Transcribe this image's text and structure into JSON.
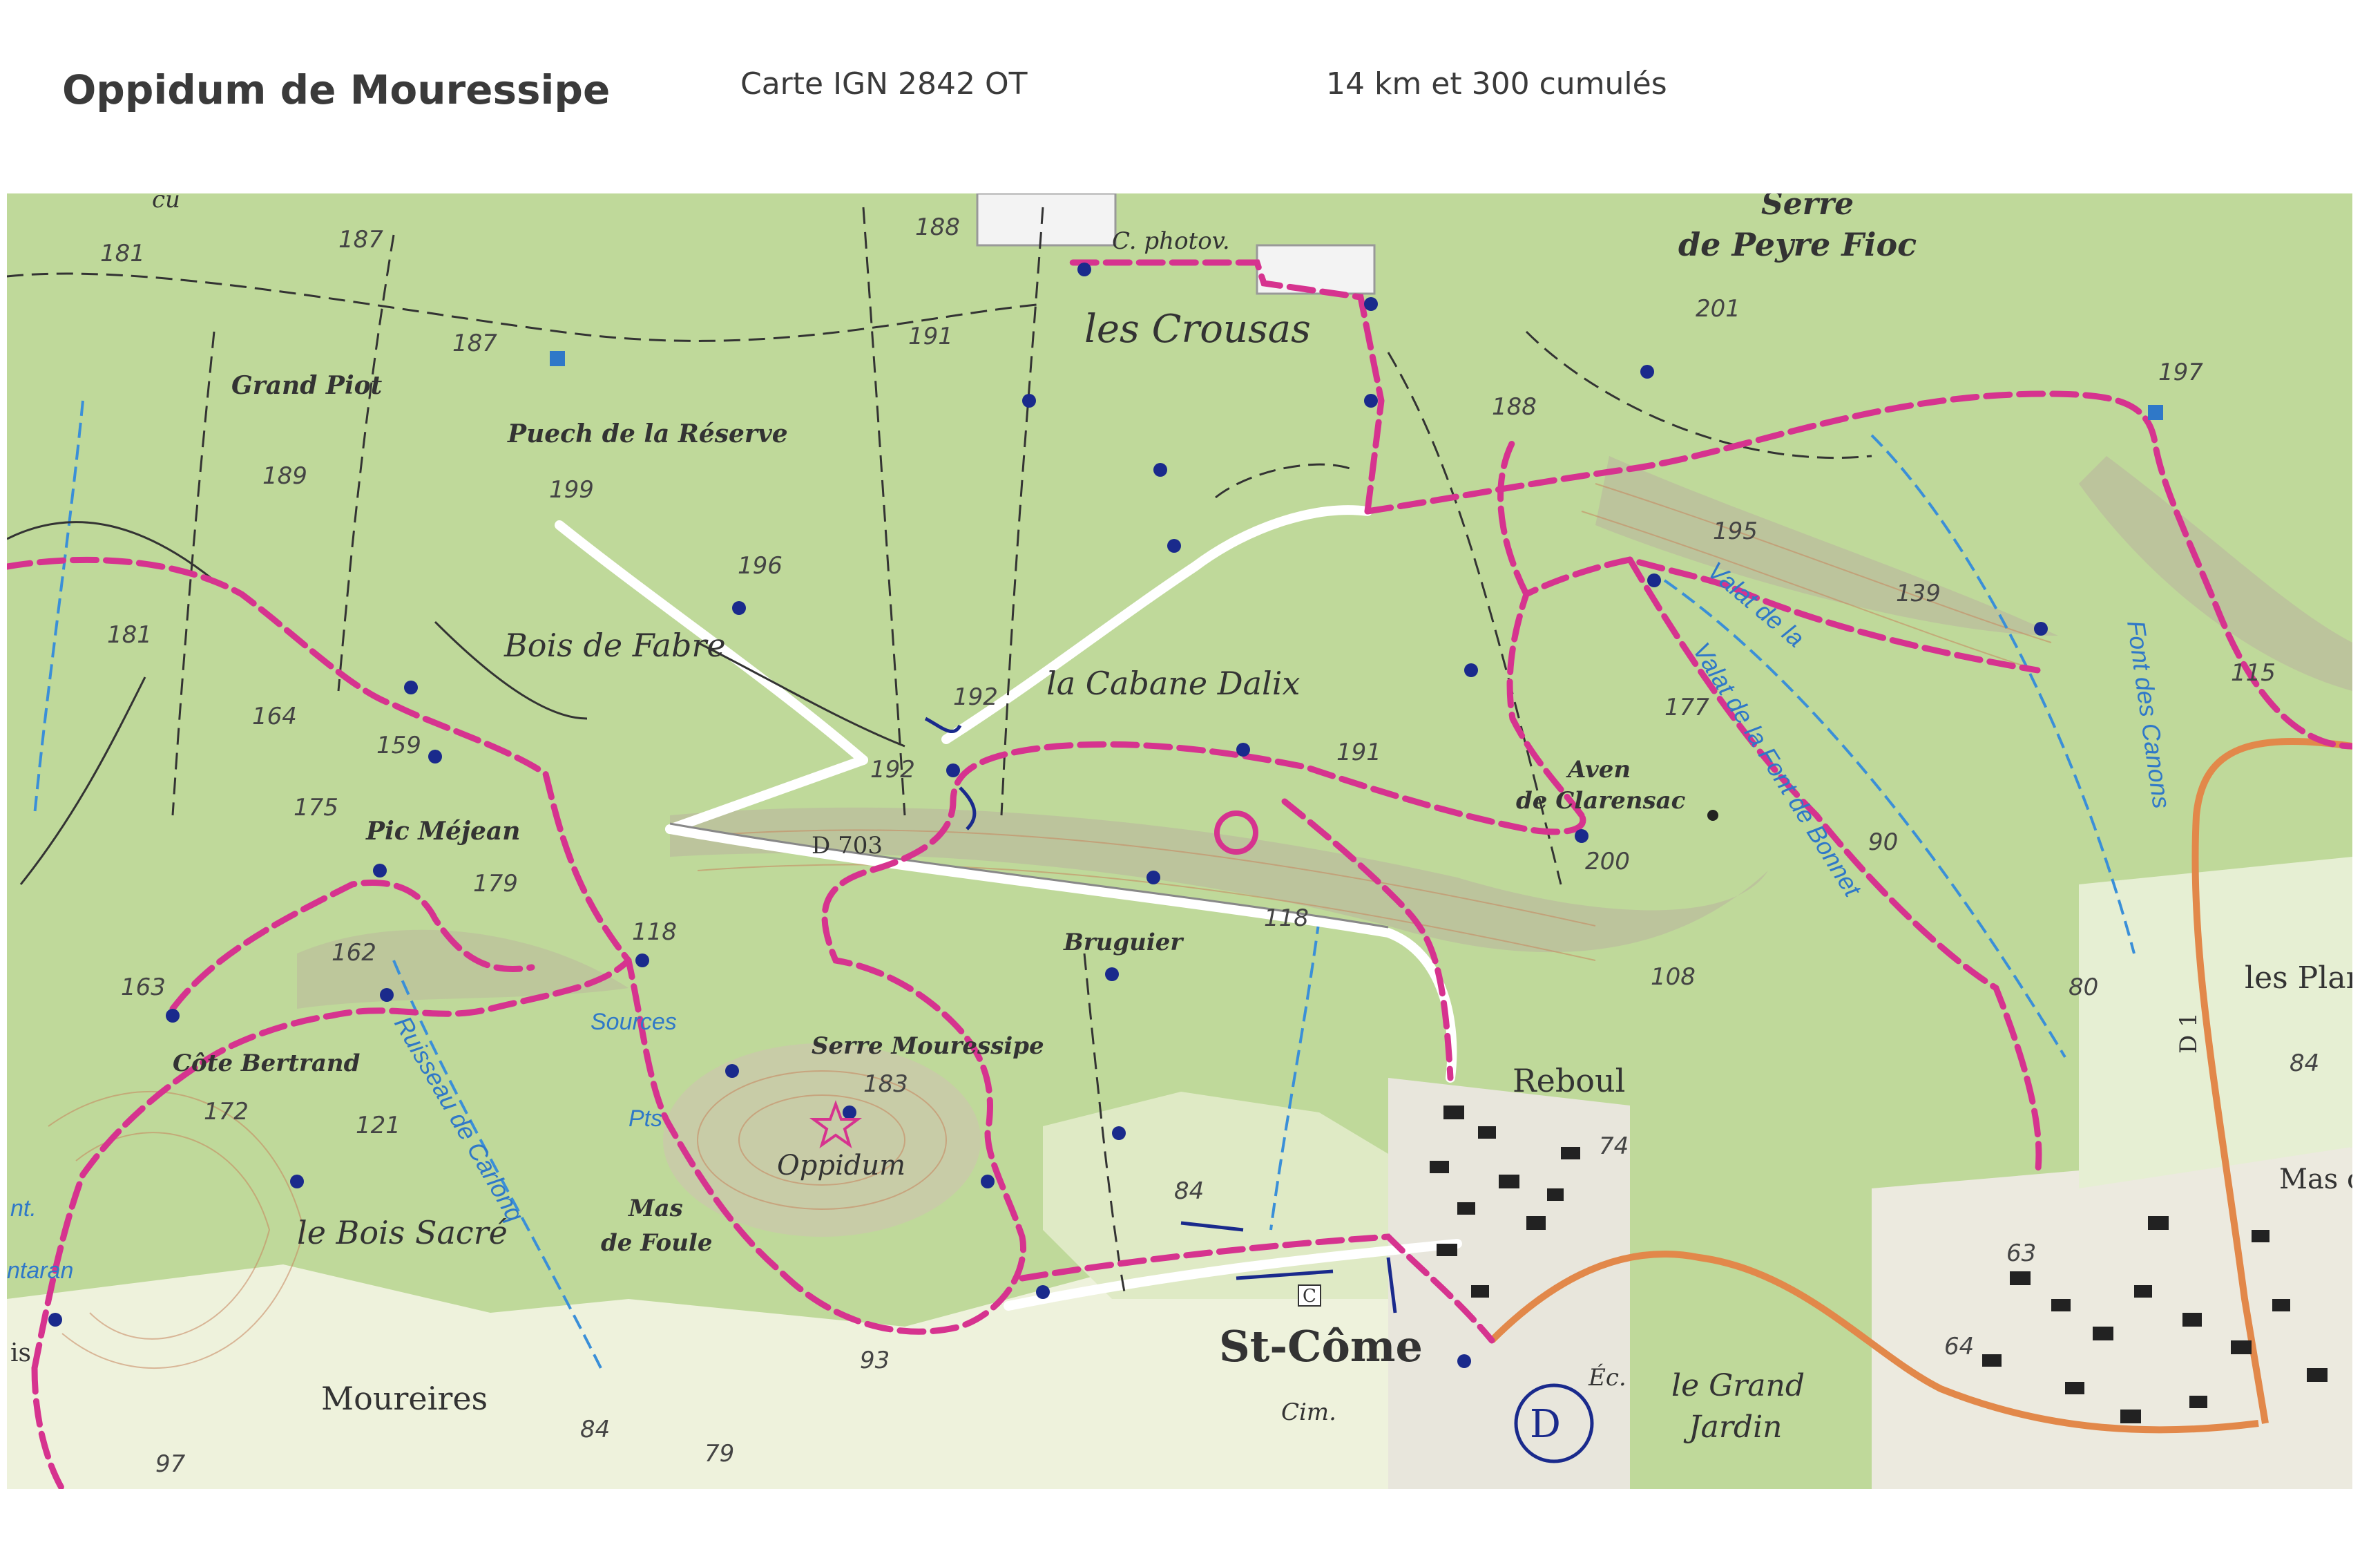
{
  "header": {
    "title": "Oppidum de Mouressipe",
    "map_sheet": "Carte IGN   2842 OT",
    "distance": "14 km et 300 cumulés"
  },
  "map": {
    "labels": {
      "serre_peyre_fioc_1": "Serre",
      "serre_peyre_fioc_2": "de Peyre Fioc",
      "c_photov": "C. photov.",
      "les_crousas": "les Crousas",
      "grand_piot": "Grand Piot",
      "puech_reserve": "Puech de la Réserve",
      "bois_de_fabre": "Bois de Fabre",
      "cabane_dalix": "la Cabane Dalix",
      "aven_1": "Aven",
      "aven_2": "de Clarensac",
      "pic_mejean": "Pic Méjean",
      "d703": "D 703",
      "bruguier": "Bruguier",
      "serre_mouressipe": "Serre Mouressipe",
      "oppidum": "Oppidum",
      "sources": "Sources",
      "pts": "Pts",
      "cote_bertrand": "Côte Bertrand",
      "le_bois_sacre": "le Bois Sacré",
      "mas_de_foule_1": "Mas",
      "mas_de_foule_2": "de Foule",
      "moureires": "Moureires",
      "st_come": "St-Côme",
      "reboul": "Reboul",
      "cim": "Cim.",
      "ec": "Éc.",
      "le_grand": "le Grand",
      "jardin": "Jardin",
      "les_plan": "les Plan",
      "mas_c": "Mas c",
      "d1": "D 1",
      "ruisseau": "Ruisseau de Carlonq",
      "valat_1": "Valat de la",
      "valat_2": "Valat de la Font de Bonnet",
      "font_canons": "Font des Canons",
      "ant": "nt.",
      "ntaran": "ntaran",
      "is_": "is",
      "cu": "cu",
      "c_sign": "C",
      "d_marker": "D"
    },
    "elevations": {
      "e181a": "181",
      "e187a": "187",
      "e188a": "188",
      "e191a": "191",
      "e187b": "187",
      "e189": "189",
      "e199": "199",
      "e196": "196",
      "e181b": "181",
      "e164": "164",
      "e159": "159",
      "e192a": "192",
      "e192b": "192",
      "e191b": "191",
      "e188b": "188",
      "e201": "201",
      "e197": "197",
      "e195": "195",
      "e139": "139",
      "e177": "177",
      "e115": "115",
      "e200": "200",
      "e90": "90",
      "e175": "175",
      "e179": "179",
      "e162": "162",
      "e163": "163",
      "e118a": "118",
      "e118b": "118",
      "e108": "108",
      "e80": "80",
      "e84a": "84",
      "e183": "183",
      "e172": "172",
      "e121": "121",
      "e74": "74",
      "e84b": "84",
      "e63": "63",
      "e64": "64",
      "e93": "93",
      "e84c": "84",
      "e79": "79",
      "e97": "97"
    },
    "colors": {
      "forest": "#bfd99a",
      "route": "#d6338f",
      "water": "#3a8fd8",
      "road_orange": "#e2884a",
      "urban": "#e8e6dc",
      "pen": "#1a2a8c"
    }
  }
}
